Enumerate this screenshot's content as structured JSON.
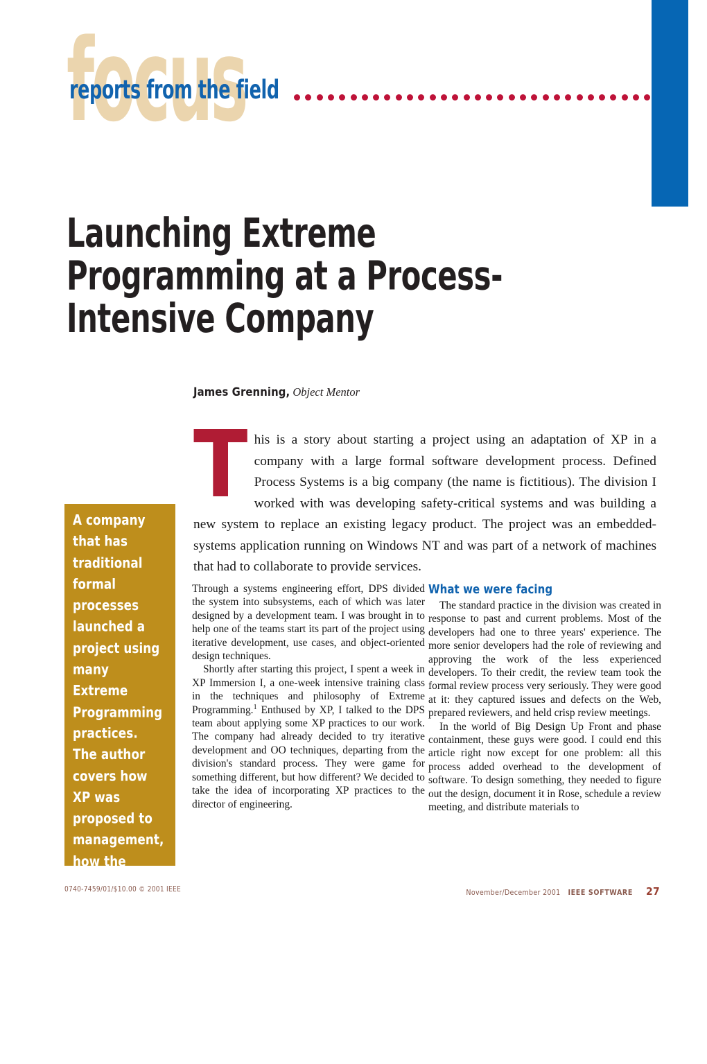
{
  "header": {
    "ghost_word": "focus",
    "kicker": "reports from the field",
    "dot_count": 32,
    "accent_blue": "#0666B4",
    "accent_tan": "#EBD5AE",
    "accent_red_dot": "#BE1238"
  },
  "article": {
    "title": "Launching Extreme Programming at a Process-Intensive Company",
    "author": "James Grenning,",
    "affiliation": "Object Mentor",
    "dropcap": "T",
    "dropcap_color": "#B01C34",
    "lead": "his is a story about starting a project using an adaptation of XP in a company with a large formal software development process. Defined Process Systems is a big company (the name is fictitious). The division I worked with was developing safety-critical systems and was building a new system to replace an existing legacy product. The project was an embedded-systems application running on Windows NT and was part of a network of machines that had to collaborate to provide services."
  },
  "pullquote": {
    "background": "#BE8E1C",
    "text": "A company that has traditional formal processes launched a project using many Extreme Programming practices. The author covers how XP was proposed to management, how the project seed began and grew, and some of the issues the team faced during its first six months."
  },
  "columns": {
    "left": {
      "paragraphs": [
        "Through a systems engineering effort, DPS divided the system into subsystems, each of which was later designed by a development team. I was brought in to help one of the teams start its part of the project using iterative development, use cases, and object-oriented design techniques.",
        "Shortly after starting this project, I spent a week in XP Immersion I, a one-week intensive training class in the techniques and philosophy of Extreme Programming.",
        "Enthused by XP, I talked to the DPS team about applying some XP practices to our work. The company had already decided to try iterative development and OO techniques, departing from the division's standard process. They were game for something different, but how different? We decided to take the idea of incorporating XP practices to the director of engineering."
      ],
      "footnote_marker": "1"
    },
    "right": {
      "heading": "What we were facing",
      "heading_color": "#0F62AE",
      "paragraphs": [
        "The standard practice in the division was created in response to past and current problems. Most of the developers had one to three years' experience. The more senior developers had the role of reviewing and approving the work of the less experienced developers. To their credit, the review team took the formal review process very seriously. They were good at it: they captured issues and defects on the Web, prepared reviewers, and held crisp review meetings.",
        "In the world of Big Design Up Front and phase containment, these guys were good. I could end this article right now except for one problem: all this process added overhead to the development of software. To design something, they needed to figure out the design, document it in Rose, schedule a review meeting, and distribute materials to"
      ]
    }
  },
  "footer": {
    "left": "0740-7459/01/$10.00 © 2001 IEEE",
    "issue": "November/December 2001",
    "magazine": "IEEE SOFTWARE",
    "page": "27",
    "color": "#8A5A4E"
  }
}
